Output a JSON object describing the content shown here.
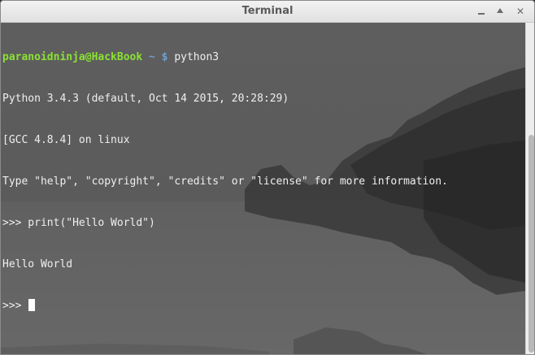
{
  "window": {
    "title": "Terminal",
    "minimize_icon": "minimize-icon",
    "maximize_icon": "maximize-icon",
    "close_label": "✕"
  },
  "terminal": {
    "prompt_user": "paranoidninja@HackBook",
    "prompt_sep": " ~ $ ",
    "command": "python3",
    "lines": [
      "Python 3.4.3 (default, Oct 14 2015, 20:28:29)",
      "[GCC 4.8.4] on linux",
      "Type \"help\", \"copyright\", \"credits\" or \"license\" for more information.",
      ">>> print(\"Hello World\")",
      "Hello World"
    ],
    "final_prompt": ">>> "
  },
  "colors": {
    "prompt_user": "#8ae234",
    "prompt_path": "#729fcf",
    "text": "#efefef"
  }
}
